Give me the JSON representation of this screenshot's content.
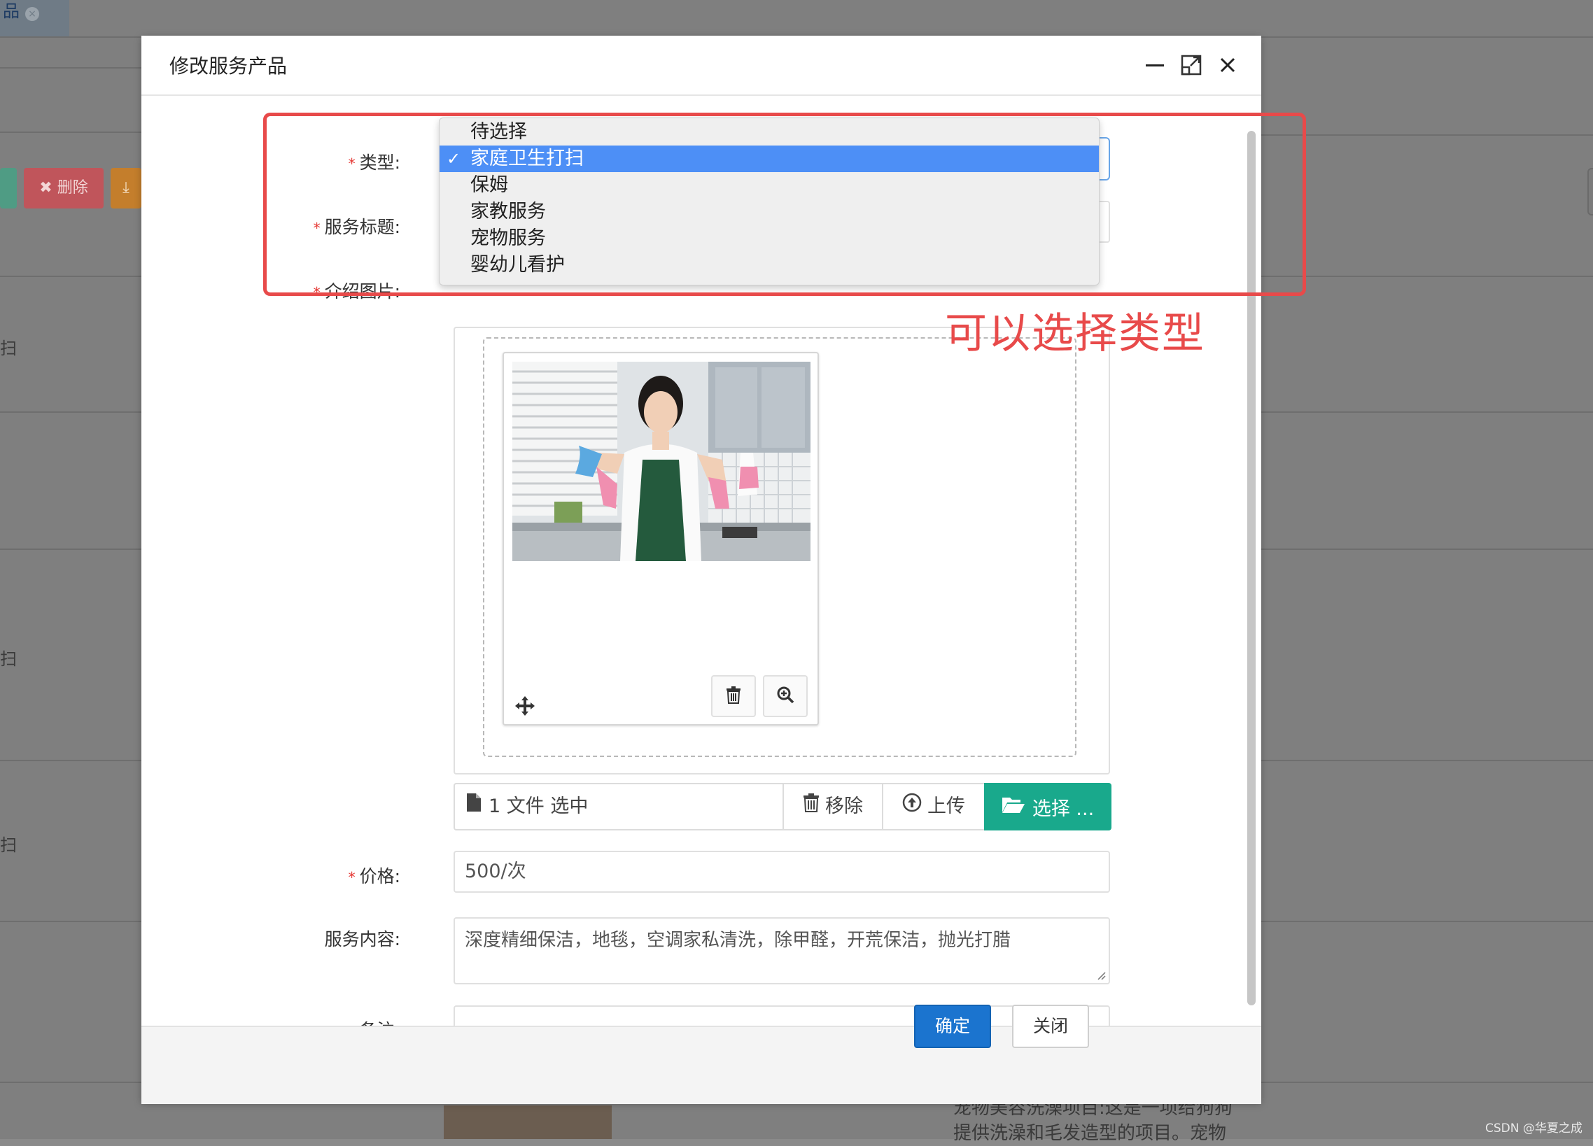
{
  "background": {
    "tab_label": "品",
    "delete_button": "删除",
    "side_rows": [
      "扫",
      "扫",
      "扫"
    ],
    "description_lines": [
      "宠物美容洗澡项目:这是一项给狗狗",
      "提供洗澡和毛发造型的项目。宠物"
    ]
  },
  "modal": {
    "title": "修改服务产品",
    "minimize_icon": "minimize-icon",
    "maximize_icon": "maximize-icon",
    "close_icon": "close-icon"
  },
  "form": {
    "type_label": "类型:",
    "title_label": "服务标题:",
    "image_label": "介绍图片:",
    "price_label": "价格:",
    "price_value": "500/次",
    "content_label": "服务内容:",
    "content_value": "深度精细保洁，地毯，空调家私清洗，除甲醛，开荒保洁，抛光打腊",
    "remark_label": "备注:",
    "remark_value": ""
  },
  "type_dropdown": {
    "options": [
      "待选择",
      "家庭卫生打扫",
      "保姆",
      "家教服务",
      "宠物服务",
      "婴幼儿看护"
    ],
    "selected": "家庭卫生打扫"
  },
  "file_input": {
    "caption": "1 文件 选中",
    "remove_label": "移除",
    "upload_label": "上传",
    "select_label": "选择 ..."
  },
  "footer": {
    "confirm_label": "确定",
    "close_label": "关闭"
  },
  "annotation": {
    "text": "可以选择类型"
  },
  "watermark": "CSDN @华夏之成",
  "colors": {
    "primary": "#1b74cf",
    "select_button": "#19a98c",
    "annotation": "#e84a4a",
    "option_highlight": "#4d8ff6"
  }
}
